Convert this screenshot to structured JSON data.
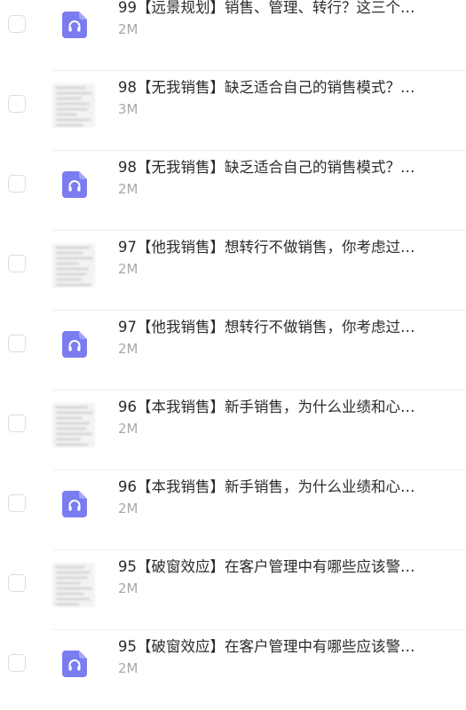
{
  "items": [
    {
      "title": "99【远景规划】销售、管理、转行？这三个…",
      "size": "2M",
      "kind": "audio"
    },
    {
      "title": "98【无我销售】缺乏适合自己的销售模式？…",
      "size": "3M",
      "kind": "doc"
    },
    {
      "title": "98【无我销售】缺乏适合自己的销售模式？…",
      "size": "2M",
      "kind": "audio"
    },
    {
      "title": "97【他我销售】想转行不做销售，你考虑过…",
      "size": "2M",
      "kind": "doc"
    },
    {
      "title": "97【他我销售】想转行不做销售，你考虑过…",
      "size": "2M",
      "kind": "audio"
    },
    {
      "title": "96【本我销售】新手销售，为什么业绩和心…",
      "size": "2M",
      "kind": "doc"
    },
    {
      "title": "96【本我销售】新手销售，为什么业绩和心…",
      "size": "2M",
      "kind": "audio"
    },
    {
      "title": "95【破窗效应】在客户管理中有哪些应该警…",
      "size": "2M",
      "kind": "doc"
    },
    {
      "title": "95【破窗效应】在客户管理中有哪些应该警…",
      "size": "2M",
      "kind": "audio"
    }
  ],
  "colors": {
    "audio_icon": "#7b7cf0",
    "title": "#2b2b2b",
    "size": "#a8a8a8"
  },
  "icons": {
    "audio": "headphones-file-icon",
    "doc": "document-thumbnail"
  }
}
